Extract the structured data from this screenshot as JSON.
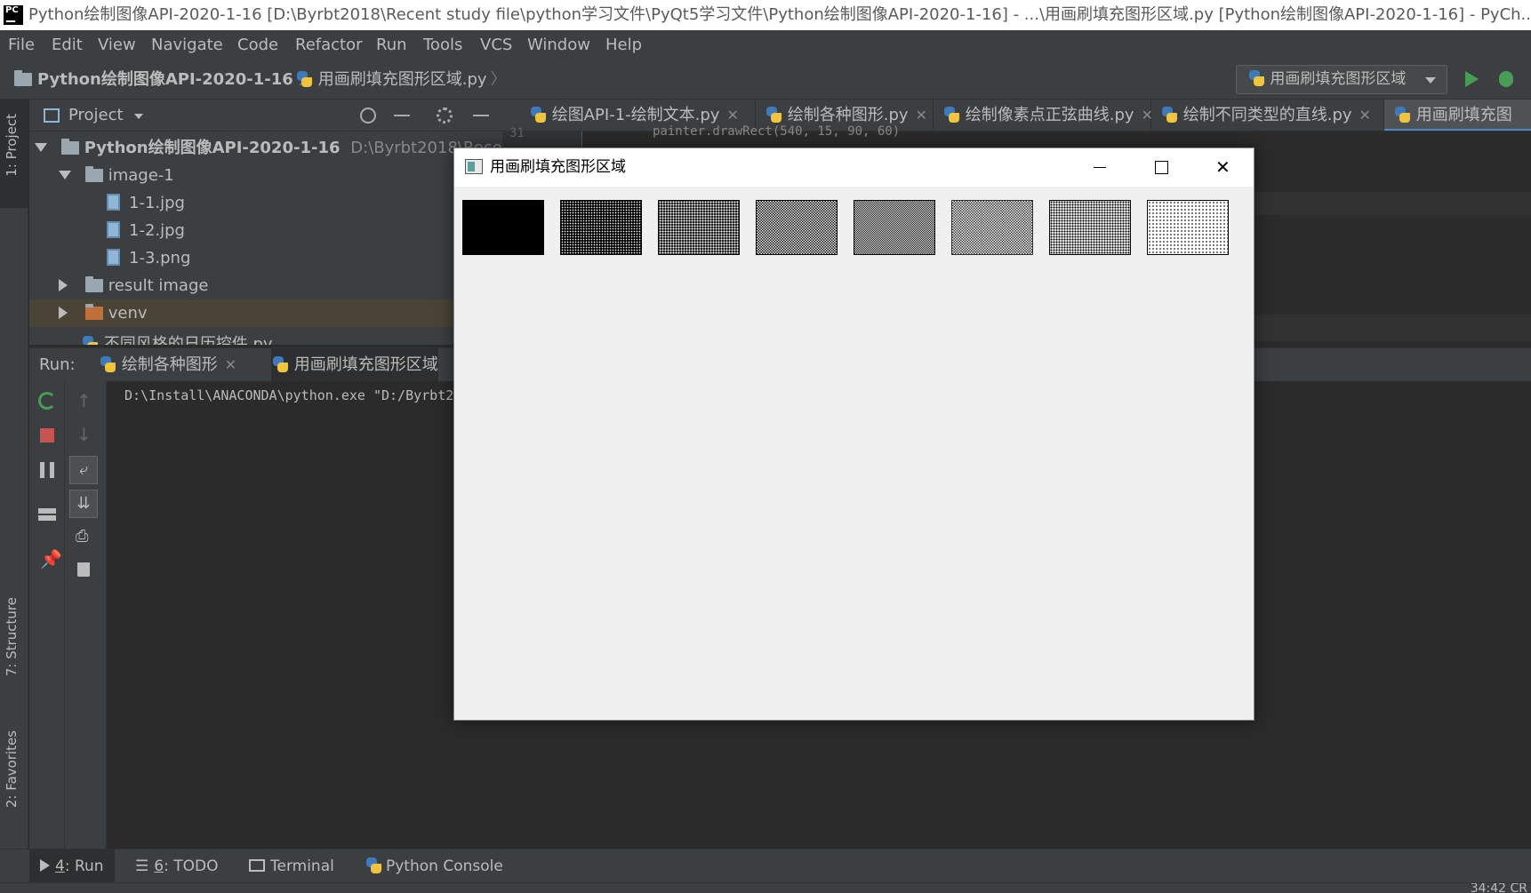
{
  "window_title": "Python绘制图像API-2020-1-16 [D:\\Byrbt2018\\Recent study file\\python学习文件\\PyQt5学习文件\\Python绘制图像API-2020-1-16] - ...\\用画刷填充图形区域.py [Python绘制图像API-2020-1-16] - PyCh...",
  "menu": [
    "File",
    "Edit",
    "View",
    "Navigate",
    "Code",
    "Refactor",
    "Run",
    "Tools",
    "VCS",
    "Window",
    "Help"
  ],
  "breadcrumb": {
    "project": "Python绘制图像API-2020-1-16",
    "file": "用画刷填充图形区域.py"
  },
  "run_config": "用画刷填充图形区域",
  "left_tabs": {
    "project": "1: Project",
    "structure": "7: Structure",
    "favorites": "2: Favorites"
  },
  "project_panel": {
    "title": "Project",
    "tree": [
      {
        "label": "Python绘制图像API-2020-1-16",
        "path": "D:\\Byrbt2018\\Recent"
      },
      {
        "label": "image-1"
      },
      {
        "label": "1-1.jpg"
      },
      {
        "label": "1-2.jpg"
      },
      {
        "label": "1-3.png"
      },
      {
        "label": "result image"
      },
      {
        "label": "venv"
      },
      {
        "label": "不同风格的日历控件.py"
      }
    ]
  },
  "editor": {
    "tabs": [
      "绘图API-1-绘制文本.py",
      "绘制各种图形.py",
      "绘制像素点正弦曲线.py",
      "绘制不同类型的直线.py",
      "用画刷填充图"
    ],
    "line_number": "31",
    "code_line": "painter.drawRect(540, 15, 90, 60)"
  },
  "run_panel": {
    "label": "Run:",
    "tabs": [
      "绘制各种图形",
      "用画刷填充图形区域"
    ],
    "console_line": "D:\\Install\\ANACONDA\\python.exe \"D:/Byrbt2"
  },
  "bottom_tabs": [
    {
      "num": "4",
      "label": ": Run"
    },
    {
      "num": "6",
      "label": ": TODO"
    },
    {
      "num": "",
      "label": "Terminal"
    },
    {
      "num": "",
      "label": "Python Console"
    }
  ],
  "status_right": "34:42  CR",
  "app_window": {
    "title": "用画刷填充图形区域",
    "swatches": [
      {
        "pattern": "solid"
      },
      {
        "pattern": "dense1"
      },
      {
        "pattern": "dense2"
      },
      {
        "pattern": "dense3"
      },
      {
        "pattern": "dense4"
      },
      {
        "pattern": "dense5"
      },
      {
        "pattern": "dense6"
      },
      {
        "pattern": "dense7"
      }
    ]
  },
  "colors": {
    "ide_bg": "#2b2b2b",
    "panel": "#3c3f41",
    "accent": "#4a88c7",
    "run_green": "#499c54"
  }
}
